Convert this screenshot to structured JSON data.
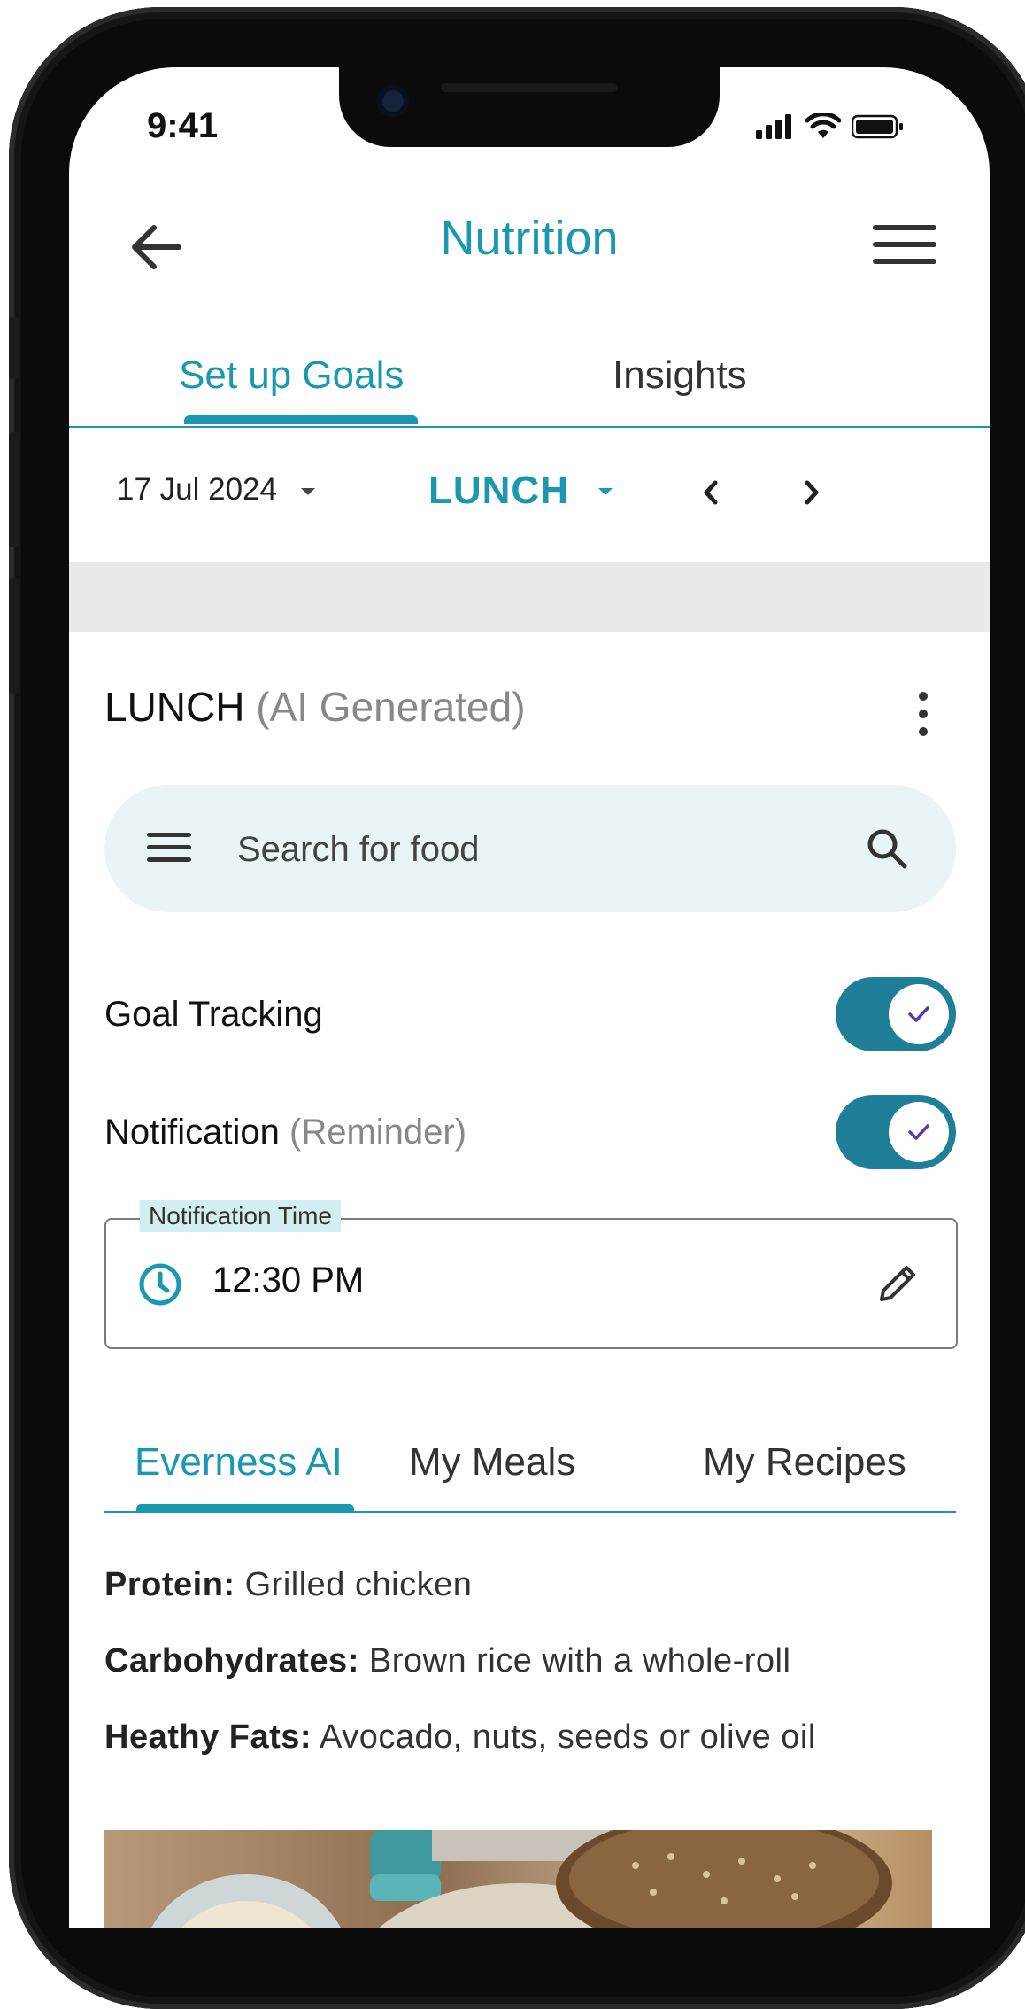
{
  "status_bar": {
    "time": "9:41"
  },
  "header": {
    "title": "Nutrition"
  },
  "top_tabs": [
    {
      "label": "Set up Goals",
      "active": true
    },
    {
      "label": "Insights",
      "active": false
    }
  ],
  "date_selector": {
    "date": "17 Jul 2024",
    "meal": "LUNCH"
  },
  "section": {
    "title": "LUNCH",
    "subtitle": "(AI Generated)"
  },
  "search": {
    "placeholder": "Search for food"
  },
  "toggles": [
    {
      "label": "Goal Tracking",
      "sublabel": "",
      "on": true
    },
    {
      "label": "Notification",
      "sublabel": "(Reminder)",
      "on": true
    }
  ],
  "notification_time": {
    "legend": "Notification Time",
    "value": "12:30 PM"
  },
  "sub_tabs": [
    {
      "label": "Everness AI",
      "active": true
    },
    {
      "label": "My Meals",
      "active": false
    },
    {
      "label": "My Recipes",
      "active": false
    }
  ],
  "nutrition": [
    {
      "key": "Protein:",
      "value": "Grilled chicken"
    },
    {
      "key": "Carbohydrates:",
      "value": "Brown rice with a whole-roll"
    },
    {
      "key": "Heathy Fats:",
      "value": "Avocado, nuts, seeds or olive oil"
    }
  ],
  "icons": {
    "back": "back-arrow-icon",
    "menu": "hamburger-menu-icon",
    "kebab": "more-vertical-icon",
    "search": "search-icon",
    "clock": "clock-icon",
    "edit": "pencil-icon"
  },
  "colors": {
    "accent": "#1a98b0",
    "toggle_on": "#1f7e98",
    "search_bg": "#e8f4f6",
    "check": "#5a3aa6"
  }
}
